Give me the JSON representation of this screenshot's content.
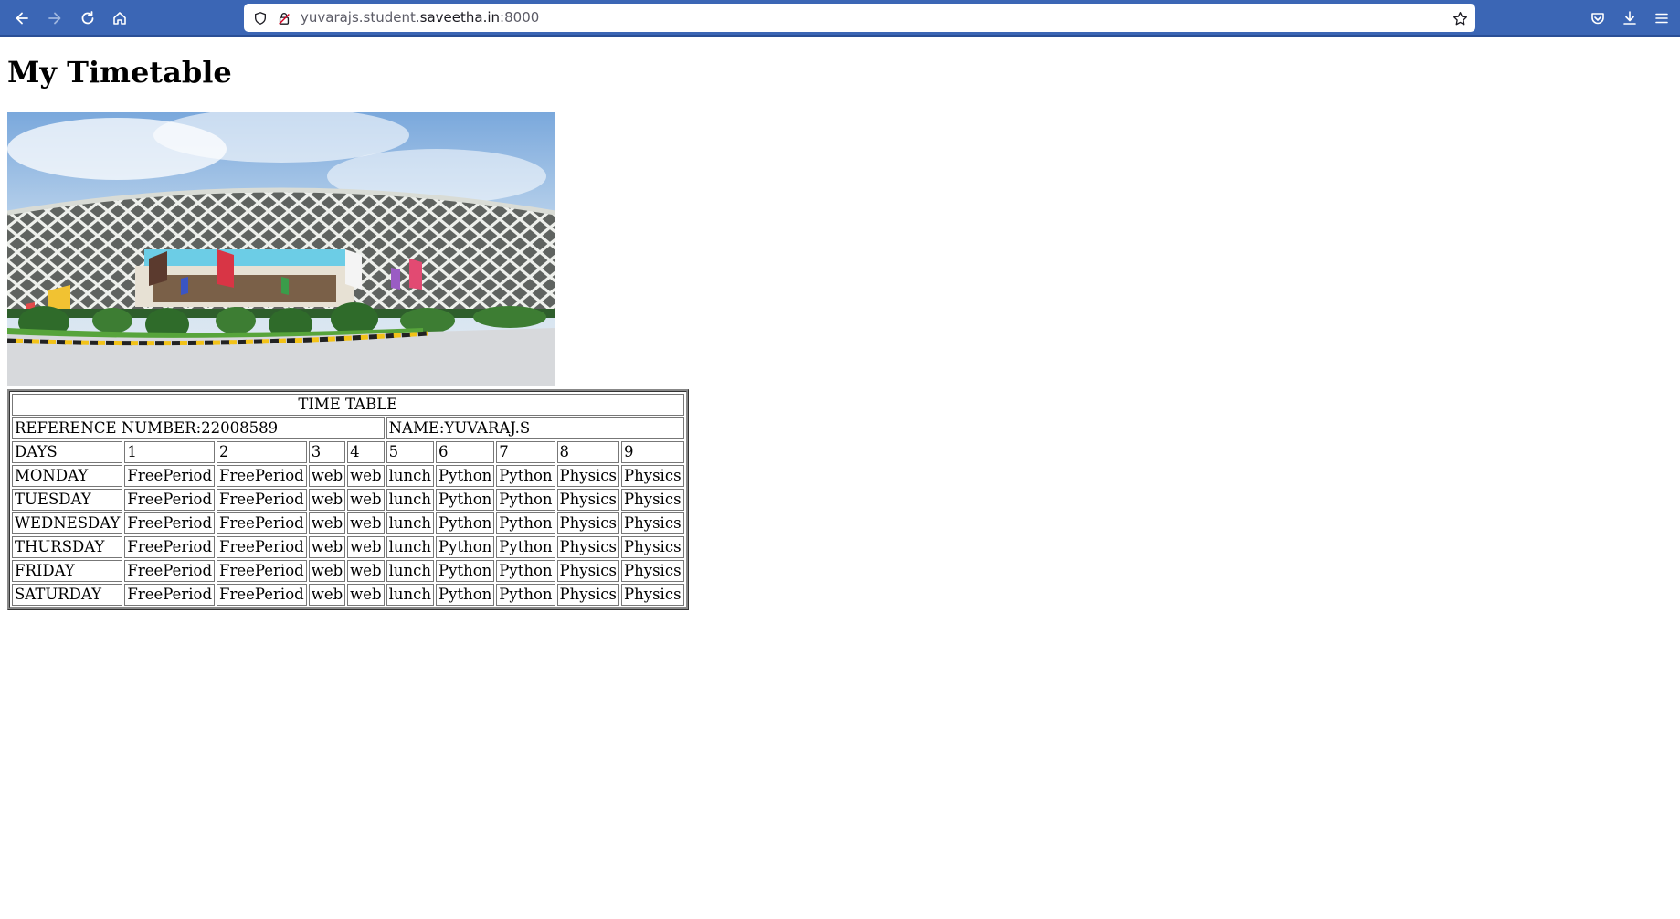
{
  "browser": {
    "url_host_prefix": "yuvarajs.student.",
    "url_host_main": "saveetha.in",
    "url_port": ":8000",
    "icons": {
      "back": "back-arrow-icon",
      "forward": "forward-arrow-icon",
      "reload": "reload-icon",
      "home": "home-icon",
      "shield": "shield-icon",
      "lock": "lock-icon",
      "bookmark": "star-icon",
      "pocket": "pocket-icon",
      "downloads": "download-icon",
      "menu": "hamburger-menu-icon"
    },
    "colors": {
      "toolbar": "#3b66b5",
      "url_bg": "#ffffff"
    }
  },
  "page": {
    "title": "My Timetable",
    "image_alt": "campus building"
  },
  "timetable": {
    "caption": "TIME TABLE",
    "reference": "REFERENCE NUMBER:22008589",
    "name": "NAME:YUVARAJ.S",
    "header": [
      "DAYS",
      "1",
      "2",
      "3",
      "4",
      "5",
      "6",
      "7",
      "8",
      "9"
    ],
    "rows": [
      [
        "MONDAY",
        "FreePeriod",
        "FreePeriod",
        "web",
        "web",
        "lunch",
        "Python",
        "Python",
        "Physics",
        "Physics"
      ],
      [
        "TUESDAY",
        "FreePeriod",
        "FreePeriod",
        "web",
        "web",
        "lunch",
        "Python",
        "Python",
        "Physics",
        "Physics"
      ],
      [
        "WEDNESDAY",
        "FreePeriod",
        "FreePeriod",
        "web",
        "web",
        "lunch",
        "Python",
        "Python",
        "Physics",
        "Physics"
      ],
      [
        "THURSDAY",
        "FreePeriod",
        "FreePeriod",
        "web",
        "web",
        "lunch",
        "Python",
        "Python",
        "Physics",
        "Physics"
      ],
      [
        "FRIDAY",
        "FreePeriod",
        "FreePeriod",
        "web",
        "web",
        "lunch",
        "Python",
        "Python",
        "Physics",
        "Physics"
      ],
      [
        "SATURDAY",
        "FreePeriod",
        "FreePeriod",
        "web",
        "web",
        "lunch",
        "Python",
        "Python",
        "Physics",
        "Physics"
      ]
    ]
  }
}
